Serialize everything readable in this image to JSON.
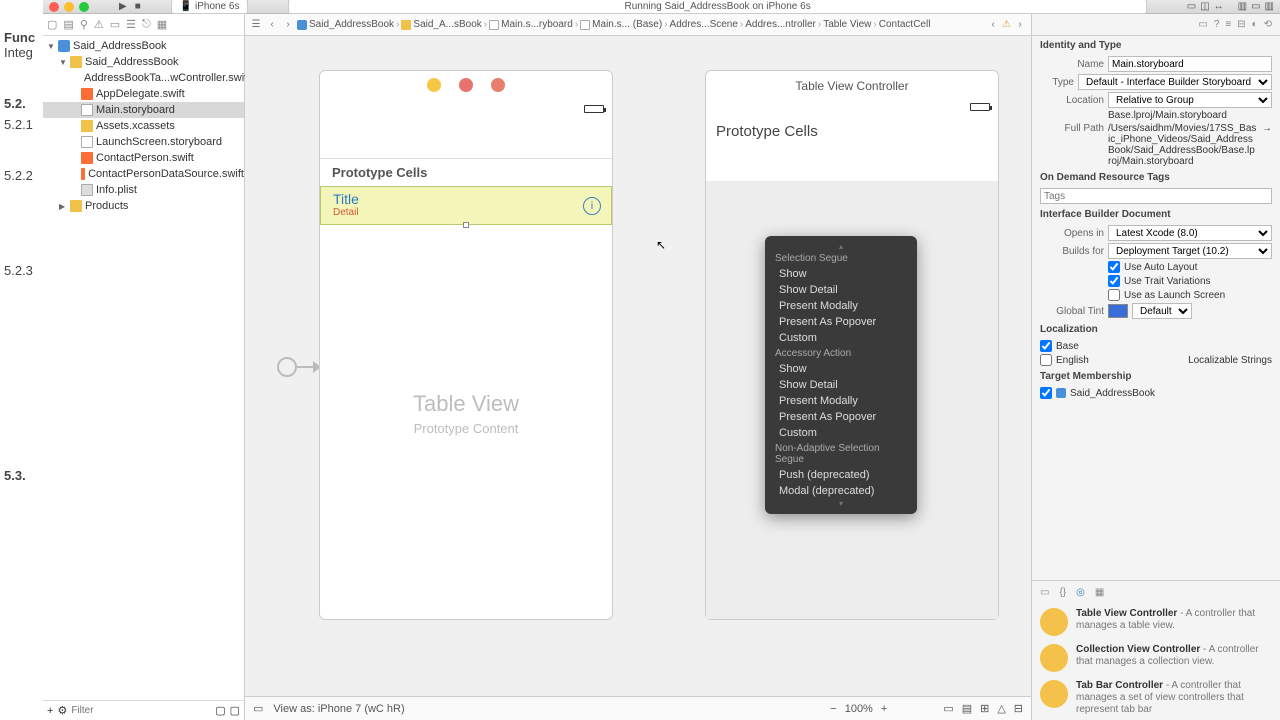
{
  "bg": {
    "l1": "Func",
    "l2": "Integ",
    "l3": "5.2.",
    "l4": "5.2.1",
    "l5": "5.2.2",
    "l6": "5.2.3",
    "l7": "5.3."
  },
  "titlebar": {
    "running": "Running Said_AddressBook on iPhone 6s",
    "target": "iPhone 6s"
  },
  "nav": {
    "project": "Said_AddressBook",
    "group": "Said_AddressBook",
    "files": [
      "AddressBookTa...wController.swift",
      "AppDelegate.swift",
      "Main.storyboard",
      "Assets.xcassets",
      "LaunchScreen.storyboard",
      "ContactPerson.swift",
      "ContactPersonDataSource.swift",
      "Info.plist"
    ],
    "products": "Products",
    "filter_ph": "Filter"
  },
  "jump": {
    "c1": "Said_AddressBook",
    "c2": "Said_A...sBook",
    "c3": "Main.s...ryboard",
    "c4": "Main.s... (Base)",
    "c5": "Addres...Scene",
    "c6": "Addres...ntroller",
    "c7": "Table View",
    "c8": "ContactCell"
  },
  "scene1": {
    "proto": "Prototype Cells",
    "title": "Title",
    "detail": "Detail",
    "tv": "Table View",
    "pc": "Prototype Content"
  },
  "scene2": {
    "hdr": "Table View Controller",
    "proto": "Prototype Cells"
  },
  "popup": {
    "g1": "Selection Segue",
    "i1": "Show",
    "i2": "Show Detail",
    "i3": "Present Modally",
    "i4": "Present As Popover",
    "i5": "Custom",
    "g2": "Accessory Action",
    "i6": "Show",
    "i7": "Show Detail",
    "i8": "Present Modally",
    "i9": "Present As Popover",
    "i10": "Custom",
    "g3": "Non-Adaptive Selection Segue",
    "i11": "Push (deprecated)",
    "i12": "Modal (deprecated)"
  },
  "canvasbar": {
    "viewas": "View as: iPhone 7 (wC hR)",
    "zoom": "100%"
  },
  "insp": {
    "identity": "Identity and Type",
    "name_l": "Name",
    "name_v": "Main.storyboard",
    "type_l": "Type",
    "type_v": "Default - Interface Builder Storyboard",
    "loc_l": "Location",
    "loc_v": "Relative to Group",
    "loc_sub": "Base.lproj/Main.storyboard",
    "fp_l": "Full Path",
    "fp_v": "/Users/saidhm/Movies/17SS_Basic_iPhone_Videos/Said_AddressBook/Said_AddressBook/Base.lproj/Main.storyboard",
    "odt": "On Demand Resource Tags",
    "tags_ph": "Tags",
    "ibd": "Interface Builder Document",
    "opens_l": "Opens in",
    "opens_v": "Latest Xcode (8.0)",
    "builds_l": "Builds for",
    "builds_v": "Deployment Target (10.2)",
    "al": "Use Auto Layout",
    "tv": "Use Trait Variations",
    "ls": "Use as Launch Screen",
    "gt_l": "Global Tint",
    "gt_v": "Default",
    "loc": "Localization",
    "l_base": "Base",
    "l_en": "English",
    "l_strings": "Localizable Strings",
    "tm": "Target Membership",
    "tm_v": "Said_AddressBook"
  },
  "objlib": {
    "i1_t": "Table View Controller",
    "i1_d": " - A controller that manages a table view.",
    "i2_t": "Collection View Controller",
    "i2_d": " - A controller that manages a collection view.",
    "i3_t": "Tab Bar Controller",
    "i3_d": " - A controller that manages a set of view controllers that represent tab bar"
  }
}
